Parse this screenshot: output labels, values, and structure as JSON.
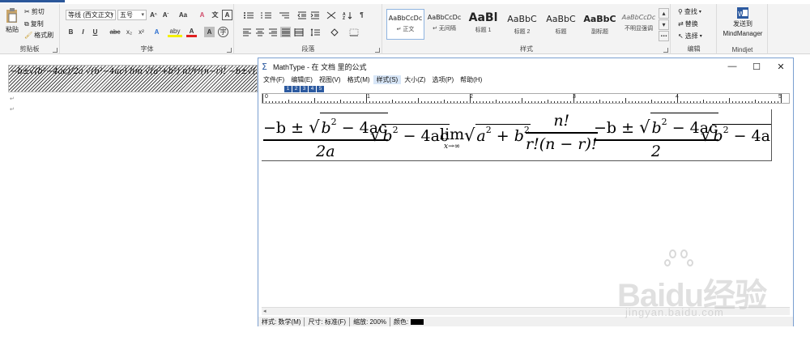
{
  "ribbon": {
    "clipboard": {
      "paste": "粘贴",
      "cut": "剪切",
      "copy": "复制",
      "format_painter": "格式刷",
      "label": "剪贴板"
    },
    "font": {
      "font_name": "等线 (西文正文)",
      "font_size": "五号",
      "grow": "A",
      "shrink": "A",
      "case": "Aa",
      "clear": "A",
      "phonetic": "文",
      "border_char": "A",
      "bold": "B",
      "italic": "I",
      "underline": "U",
      "strike": "abc",
      "subscript": "x₂",
      "superscript": "x²",
      "effects": "A",
      "highlight": "aby",
      "font_color": "A",
      "shading": "A",
      "enclose": "字",
      "label": "字体"
    },
    "paragraph": {
      "label": "段落"
    },
    "styles": {
      "label": "样式",
      "items": [
        {
          "sample": "AaBbCcDc",
          "name": "↵ 正文"
        },
        {
          "sample": "AaBbCcDc",
          "name": "↵ 无间隔"
        },
        {
          "sample": "AaBl",
          "name": "标题 1"
        },
        {
          "sample": "AaBbC",
          "name": "标题 2"
        },
        {
          "sample": "AaBbC",
          "name": "标题"
        },
        {
          "sample": "AaBbC",
          "name": "副标题"
        },
        {
          "sample": "AaBbCcDc",
          "name": "不明显强调"
        }
      ]
    },
    "editing": {
      "find": "查找",
      "replace": "替换",
      "select": "选择",
      "label": "编辑"
    },
    "mindjet": {
      "send": "发送到",
      "app": "MindManager",
      "label": "Mindjet"
    }
  },
  "document": {
    "formula_preview": "−b±√(b²−4ac)/2a  √(b²−4ac)  lim √(a²+b²)  n!/r!(n−r)!  −b±√(b²−4ac)/2  √(b²−4ac"
  },
  "mathtype": {
    "title": "MathType - 在 文档 里的公式",
    "menu": [
      "文件(F)",
      "编辑(E)",
      "视图(V)",
      "格式(M)",
      "样式(S)",
      "大小(Z)",
      "选项(P)",
      "帮助(H)"
    ],
    "ruler_numbers": [
      "0",
      "1",
      "2",
      "3",
      "4",
      "5"
    ],
    "equation": {
      "f1_num_a": "−b ± ",
      "f1_num_b": "b",
      "f1_num_c": "2",
      "f1_num_d": " − 4ac",
      "f1_den": "2a",
      "r1_b": "b",
      "r1_exp": "2",
      "r1_rest": " − 4ac",
      "lim_word": "lim",
      "lim_sub": "x→∞",
      "r2_a": "a",
      "r2_exp_a": "2",
      "r2_plus": " + ",
      "r2_b": "b",
      "r2_exp_b": "2",
      "f2_num": "n!",
      "f2_den": "r!(n − r)!",
      "f3_num_a": "−b ± ",
      "f3_num_b": "b",
      "f3_num_c": "2",
      "f3_num_d": " − 4ac",
      "f3_den": "2",
      "r3_b": "b",
      "r3_exp": "2",
      "r3_rest": " − 4ac"
    },
    "status": {
      "style": "样式: 数学(M)",
      "size": "尺寸: 标准(F)",
      "zoom": "缩放: 200%",
      "color": "颜色:"
    }
  },
  "watermark": {
    "brand": "Baidu经验",
    "url": "jingyan.baidu.com"
  }
}
